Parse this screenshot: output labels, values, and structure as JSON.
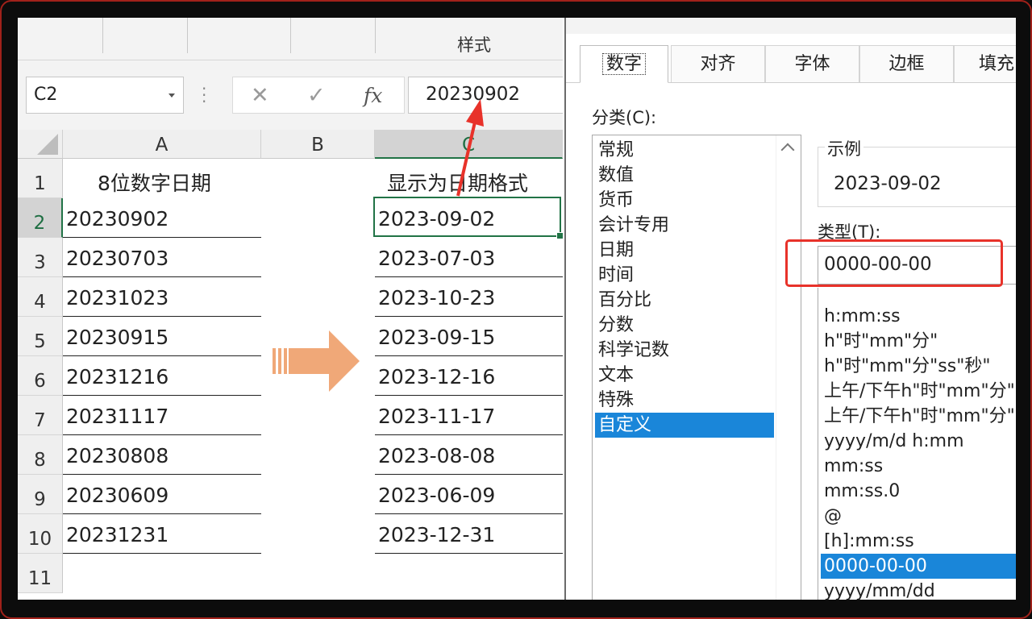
{
  "ribbon": {
    "group_label": "样式"
  },
  "formula_bar": {
    "name_box": "C2",
    "cancel_icon": "✕",
    "enter_icon": "✓",
    "fx_label": "fx",
    "value": "20230902"
  },
  "columns": [
    "A",
    "B",
    "C"
  ],
  "rows": [
    "1",
    "2",
    "3",
    "4",
    "5",
    "6",
    "7",
    "8",
    "9",
    "10",
    "11"
  ],
  "sheet": {
    "header_a": "8位数字日期",
    "header_c": "显示为日期格式",
    "col_a": [
      "20230902",
      "20230703",
      "20231023",
      "20230915",
      "20231216",
      "20231117",
      "20230808",
      "20230609",
      "20231231"
    ],
    "col_c": [
      "2023-09-02",
      "2023-07-03",
      "2023-10-23",
      "2023-09-15",
      "2023-12-16",
      "2023-11-17",
      "2023-08-08",
      "2023-06-09",
      "2023-12-31"
    ]
  },
  "dialog": {
    "tabs": [
      "数字",
      "对齐",
      "字体",
      "边框",
      "填充"
    ],
    "active_tab": "数字",
    "category_label": "分类(C):",
    "categories": [
      "常规",
      "数值",
      "货币",
      "会计专用",
      "日期",
      "时间",
      "百分比",
      "分数",
      "科学记数",
      "文本",
      "特殊",
      "自定义"
    ],
    "selected_category": "自定义",
    "sample_label": "示例",
    "sample_value": "2023-09-02",
    "type_label": "类型(T):",
    "type_value": "0000-00-00",
    "formats": [
      "h:mm:ss",
      "h\"时\"mm\"分\"",
      "h\"时\"mm\"分\"ss\"秒\"",
      "上午/下午h\"时\"mm\"分\"",
      "上午/下午h\"时\"mm\"分\"",
      "yyyy/m/d h:mm",
      "mm:ss",
      "mm:ss.0",
      "@",
      "[h]:mm:ss",
      "0000-00-00",
      "yyyy/mm/dd"
    ],
    "selected_format": "0000-00-00"
  },
  "colors": {
    "accent": "#217346",
    "selection": "#1a86d9",
    "highlight": "#e8322a",
    "arrow": "#f0a878"
  }
}
